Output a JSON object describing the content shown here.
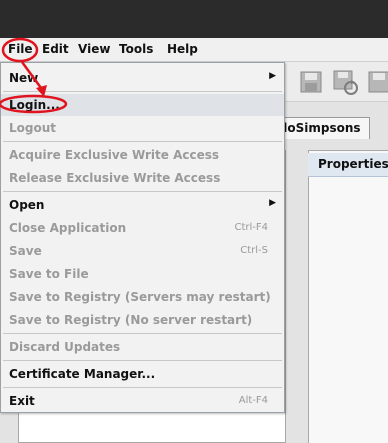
{
  "menubar": {
    "file_label": "File",
    "edit_label": "Edit",
    "view_label": "View",
    "tools_label": "Tools",
    "help_label": "Help"
  },
  "file_menu": {
    "items": [
      {
        "label": "New",
        "submenu": true,
        "enabled": true
      },
      {
        "label": "Login...",
        "enabled": true
      },
      {
        "label": "Logout",
        "enabled": false
      },
      {
        "label": "Acquire Exclusive Write Access",
        "enabled": false
      },
      {
        "label": "Release Exclusive Write Access",
        "enabled": false
      },
      {
        "label": "Open",
        "submenu": true,
        "enabled": true
      },
      {
        "label": "Close Application",
        "accelerator": "Ctrl-F4",
        "enabled": false
      },
      {
        "label": "Save",
        "accelerator": "Ctrl-S",
        "enabled": false
      },
      {
        "label": "Save to File",
        "enabled": false
      },
      {
        "label": "Save to Registry (Servers may restart)",
        "enabled": false
      },
      {
        "label": "Save to Registry (No server restart)",
        "enabled": false
      },
      {
        "label": "Discard Updates",
        "enabled": false
      },
      {
        "label": "Certificate Manager...",
        "enabled": true
      },
      {
        "label": "Exit",
        "accelerator": "Alt-F4",
        "enabled": true
      }
    ]
  },
  "tabs": {
    "hello_label": "elloSimpsons"
  },
  "properties": {
    "title": "Properties"
  },
  "toolbar_icons": [
    "save-icon",
    "refresh-save-icon",
    "save-all-icon"
  ],
  "colors": {
    "annotation": "#e0141e",
    "menu_highlight": "#dfe3e8",
    "titlebar": "#2b2b2b"
  }
}
